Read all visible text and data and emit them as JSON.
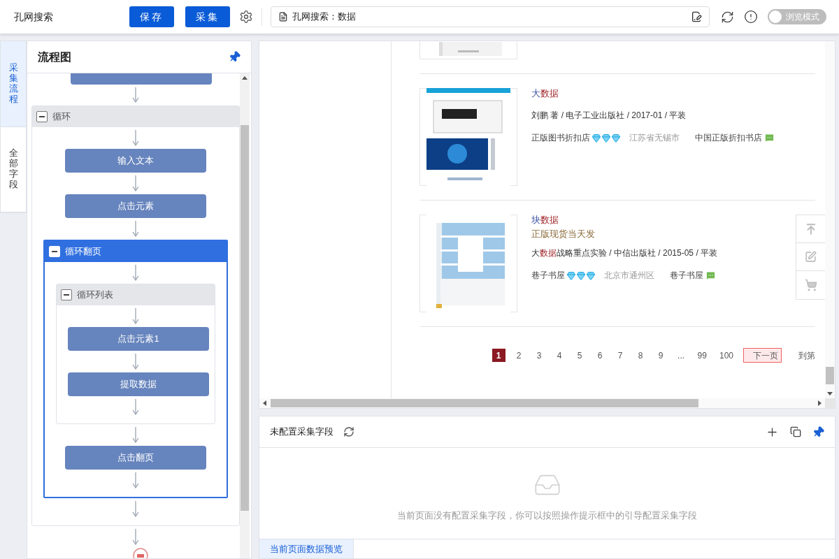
{
  "app": {
    "title": "孔网搜索"
  },
  "toolbar": {
    "buttons": [
      "保存",
      "采集"
    ],
    "address": "孔网搜索：数据",
    "browse_mode": {
      "label": "浏览模式",
      "on": false
    }
  },
  "side_tabs": [
    {
      "label": "采集流程",
      "selected": true
    },
    {
      "label": "全部字段",
      "selected": false
    }
  ],
  "flow": {
    "title": "流程图",
    "steps": [
      {
        "kind": "loop",
        "label": "循环",
        "selected": false,
        "expanded": true,
        "children": [
          {
            "kind": "node",
            "label": "输入文本"
          },
          {
            "kind": "node",
            "label": "点击元素"
          },
          {
            "kind": "loop",
            "label": "循环翻页",
            "selected": true,
            "expanded": true,
            "children": [
              {
                "kind": "loop",
                "label": "循环列表",
                "selected": false,
                "expanded": true,
                "children": [
                  {
                    "kind": "node",
                    "label": "点击元素1"
                  },
                  {
                    "kind": "node",
                    "label": "提取数据"
                  }
                ]
              },
              {
                "kind": "node",
                "label": "点击翻页"
              }
            ]
          }
        ]
      }
    ]
  },
  "books": [
    {
      "title": [
        {
          "text": "大",
          "hit": false
        },
        {
          "text": "数据",
          "hit": true
        }
      ],
      "meta": [
        {
          "text": "刘鹏 著 / 电子工业出版社 / 2017-01 / 平装",
          "hit": false
        }
      ],
      "shop": "正版图书折扣店",
      "stars": 3,
      "location": "江苏省无锡市",
      "seller": "中国正版折扣书店"
    },
    {
      "title": [
        {
          "text": "块",
          "hit": false
        },
        {
          "text": "数据",
          "hit": true
        }
      ],
      "note": "正版现货当天发",
      "meta": [
        {
          "text": "大",
          "hit": false
        },
        {
          "text": "数据",
          "hit": true
        },
        {
          "text": "战略重点实验  / 中信出版社 / 2015-05 / 平装",
          "hit": false
        }
      ],
      "shop": "巷子书屋",
      "stars": 3,
      "location": "北京市通州区",
      "seller": "巷子书屋"
    }
  ],
  "pagination": {
    "pages": [
      {
        "label": "1",
        "selected": true
      },
      {
        "label": "2",
        "selected": false
      },
      {
        "label": "3",
        "selected": false
      },
      {
        "label": "4",
        "selected": false
      },
      {
        "label": "5",
        "selected": false
      },
      {
        "label": "6",
        "selected": false
      },
      {
        "label": "7",
        "selected": false
      },
      {
        "label": "8",
        "selected": false
      },
      {
        "label": "9",
        "selected": false
      },
      {
        "label": "...",
        "selected": false
      },
      {
        "label": "99",
        "selected": false
      },
      {
        "label": "100",
        "selected": false
      }
    ],
    "next": "下一页",
    "goto": "到第"
  },
  "fields": {
    "title": "未配置采集字段",
    "empty_message": "当前页面没有配置采集字段，你可以按照操作提示框中的引导配置采集字段"
  },
  "bottom_tabs": [
    {
      "label": "当前页面数据预览",
      "selected": true
    }
  ]
}
